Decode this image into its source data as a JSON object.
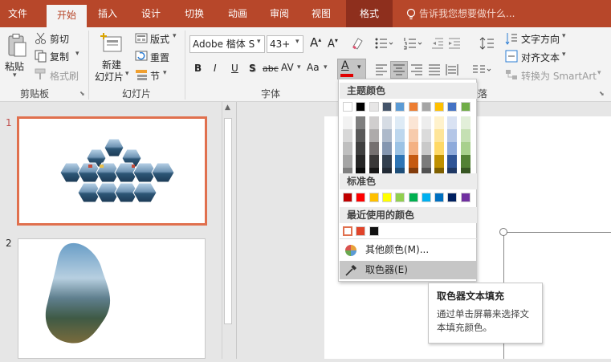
{
  "tabs": [
    {
      "label": "文件",
      "active": false
    },
    {
      "label": "开始",
      "active": true
    },
    {
      "label": "插入",
      "active": false
    },
    {
      "label": "设计",
      "active": false
    },
    {
      "label": "切换",
      "active": false
    },
    {
      "label": "动画",
      "active": false
    },
    {
      "label": "审阅",
      "active": false
    },
    {
      "label": "视图",
      "active": false
    },
    {
      "label": "格式",
      "active": false
    }
  ],
  "tell_me": "告诉我您想要做什么...",
  "clipboard": {
    "paste": "粘贴",
    "cut": "剪切",
    "copy": "复制",
    "format_painter": "格式刷",
    "group": "剪贴板"
  },
  "slides_group": {
    "new_slide": "新建",
    "new_slide2": "幻灯片",
    "layout": "版式",
    "reset": "重置",
    "section": "节",
    "group": "幻灯片"
  },
  "font_group": {
    "font_name": "Adobe 楷体 S",
    "font_size": "43+",
    "group": "字体",
    "bold": "B",
    "italic": "I",
    "underline": "U",
    "shadow": "S",
    "strike": "abc",
    "spacing": "AV",
    "case": "Aa",
    "font_color": "A"
  },
  "paragraph_group": {
    "text_direction": "文字方向",
    "align_text": "对齐文本",
    "smartart": "转换为 SmartArt",
    "group": "段落"
  },
  "slide_numbers": [
    "1",
    "2"
  ],
  "color_menu": {
    "theme_header": "主题颜色",
    "theme_top": [
      "#ffffff",
      "#000000",
      "#e7e6e6",
      "#44546a",
      "#5b9bd5",
      "#ed7d31",
      "#a5a5a5",
      "#ffc000",
      "#4472c4",
      "#70ad47"
    ],
    "theme_shades": [
      [
        "#f2f2f2",
        "#7f7f7f",
        "#d0cece",
        "#d6dce4",
        "#deebf6",
        "#fbe5d5",
        "#ededed",
        "#fff2cc",
        "#d9e2f3",
        "#e2efd9"
      ],
      [
        "#d8d8d8",
        "#595959",
        "#aeabab",
        "#adb9ca",
        "#bdd7ee",
        "#f7cbac",
        "#dbdbdb",
        "#fee599",
        "#b4c6e7",
        "#c5e0b3"
      ],
      [
        "#bfbfbf",
        "#3f3f3f",
        "#757070",
        "#8496b0",
        "#9cc3e5",
        "#f4b183",
        "#c9c9c9",
        "#ffd966",
        "#8eaadb",
        "#a8d08d"
      ],
      [
        "#a5a5a5",
        "#262626",
        "#3a3838",
        "#323f4f",
        "#2e75b5",
        "#c55a11",
        "#7b7b7b",
        "#bf9000",
        "#2f5496",
        "#538135"
      ],
      [
        "#7f7f7f",
        "#0c0c0c",
        "#171616",
        "#222a35",
        "#1e4e79",
        "#833c0b",
        "#525252",
        "#7f6000",
        "#1f3864",
        "#375623"
      ]
    ],
    "standard_header": "标准色",
    "standard": [
      "#c00000",
      "#ff0000",
      "#ffc000",
      "#ffff00",
      "#92d050",
      "#00b050",
      "#00b0f0",
      "#0070c0",
      "#002060",
      "#7030a0"
    ],
    "recent_header": "最近使用的颜色",
    "recent": [
      "#ffffff",
      "#e0442a",
      "#111111"
    ],
    "more_colors": "其他颜色(M)...",
    "eyedropper": "取色器(E)"
  },
  "tooltip": {
    "title": "取色器文本填充",
    "body": "通过单击屏幕来选择文本填充颜色。"
  }
}
